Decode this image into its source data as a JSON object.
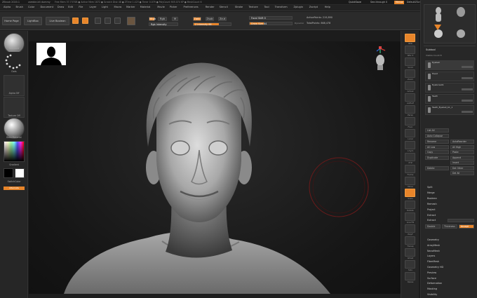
{
  "titlebar": {
    "app": "ZBrush 2020.1",
    "project": "zombie-kit dummy",
    "stats": "Free Mem 37.737GB ● Active Mem 1872 ● Scratch Disk 48 ● ZTime 1.423 ● Timer 0.079 ● PolyCount 905.074 KP ● MeshCount 6",
    "quicksave": "QuickSave",
    "seethrough": "See-through 0",
    "menus": "Menus",
    "defaultscript": "DefaultZScript"
  },
  "menus": [
    "Alpha",
    "Brush",
    "Color",
    "Document",
    "Draw",
    "Edit",
    "File",
    "Layer",
    "Light",
    "Macro",
    "Marker",
    "Material",
    "Movie",
    "Picker",
    "Preferences",
    "Render",
    "Stencil",
    "Stroke",
    "Texture",
    "Tool",
    "Transform",
    "Zplugin",
    "Zscript",
    "Help"
  ],
  "shelf": {
    "home": "Home Page",
    "lightbox": "LightBox",
    "liveboolean": "Live Boolean",
    "modes": [
      "Edit",
      "Draw",
      "Move",
      "Scale",
      "Rotate"
    ],
    "mrgb": "Mrgb",
    "rgb": "Rgb",
    "m": "M",
    "zadd": "Zadd",
    "zsub": "Zsub",
    "zcut": "Zcut",
    "rgb_intensity": "Rgb Intensity",
    "z_intensity": "Z Intensity 66",
    "focal_shift": "Focal Shift 0",
    "draw_size": "Draw Size 64",
    "dynamic": "Dynamic",
    "active_points": "ActivePoints: 219,890",
    "total_points": "TotalPoints: 868,478"
  },
  "left": {
    "brush": "Standard",
    "stroke": "Dots",
    "alpha": "Alpha Off",
    "texture": "Texture Off",
    "material": "BasicMaterial",
    "gradient": "Gradient",
    "switch": "SwitchColor",
    "alternate": "Alternate"
  },
  "right_icons": [
    {
      "label": "BPR"
    },
    {
      "label": "SPix 3"
    },
    {
      "label": "Scroll"
    },
    {
      "label": "Zoom"
    },
    {
      "label": "Actual"
    },
    {
      "label": "AAHalf"
    },
    {
      "label": "Persp"
    },
    {
      "label": "Floor"
    },
    {
      "label": "Local"
    },
    {
      "label": "L.Sym"
    },
    {
      "label": "XYZ"
    },
    {
      "label": "Frame"
    },
    {
      "label": "Move"
    },
    {
      "label": "Scale"
    },
    {
      "label": "Rotate"
    },
    {
      "label": "Line Fill"
    },
    {
      "label": "PolyF"
    },
    {
      "label": "Transp"
    },
    {
      "label": "Ghost"
    },
    {
      "label": "Solo"
    },
    {
      "label": "Xpose"
    }
  ],
  "tool": {
    "items": [
      "Head",
      "Body",
      "Ears",
      "Eyes",
      "Zsphere",
      "PolyMesh3D"
    ],
    "subtool_header": "Subtool",
    "subtools": [
      "Visible Count 8",
      "Eyeball",
      "Head",
      "Eyebrow01",
      "Teeth",
      "Teeth_Eyeball_b1_1"
    ],
    "buttons": [
      {
        "l": "List All",
        "r": ""
      },
      {
        "l": "Auto Collapse",
        "r": ""
      },
      {
        "l": "Rename",
        "r": "AutoReorder"
      },
      {
        "l": "All Low",
        "r": "All High"
      },
      {
        "l": "Copy",
        "r": "Paste"
      },
      {
        "l": "Duplicate",
        "r": "Append"
      },
      {
        "l": "",
        "r": "Insert"
      },
      {
        "l": "Delete",
        "r": "Del Other"
      },
      {
        "l": "",
        "r": "Del All"
      }
    ],
    "sections": [
      "Split",
      "Merge",
      "Boolean",
      "Remesh",
      "Project",
      "Extract"
    ],
    "extract": [
      "Extract",
      "Double",
      "Thickness",
      "Accept"
    ],
    "bottom": [
      "Geometry",
      "ArrayMesh",
      "NanoMesh",
      "Layers",
      "FiberMesh",
      "Geometry HD",
      "Preview",
      "Surface",
      "Deformation",
      "Masking",
      "Visibility"
    ]
  },
  "colors": {
    "accent": "#e8852a",
    "panel": "#272727",
    "viewport_bg": "#1a1a1a"
  }
}
